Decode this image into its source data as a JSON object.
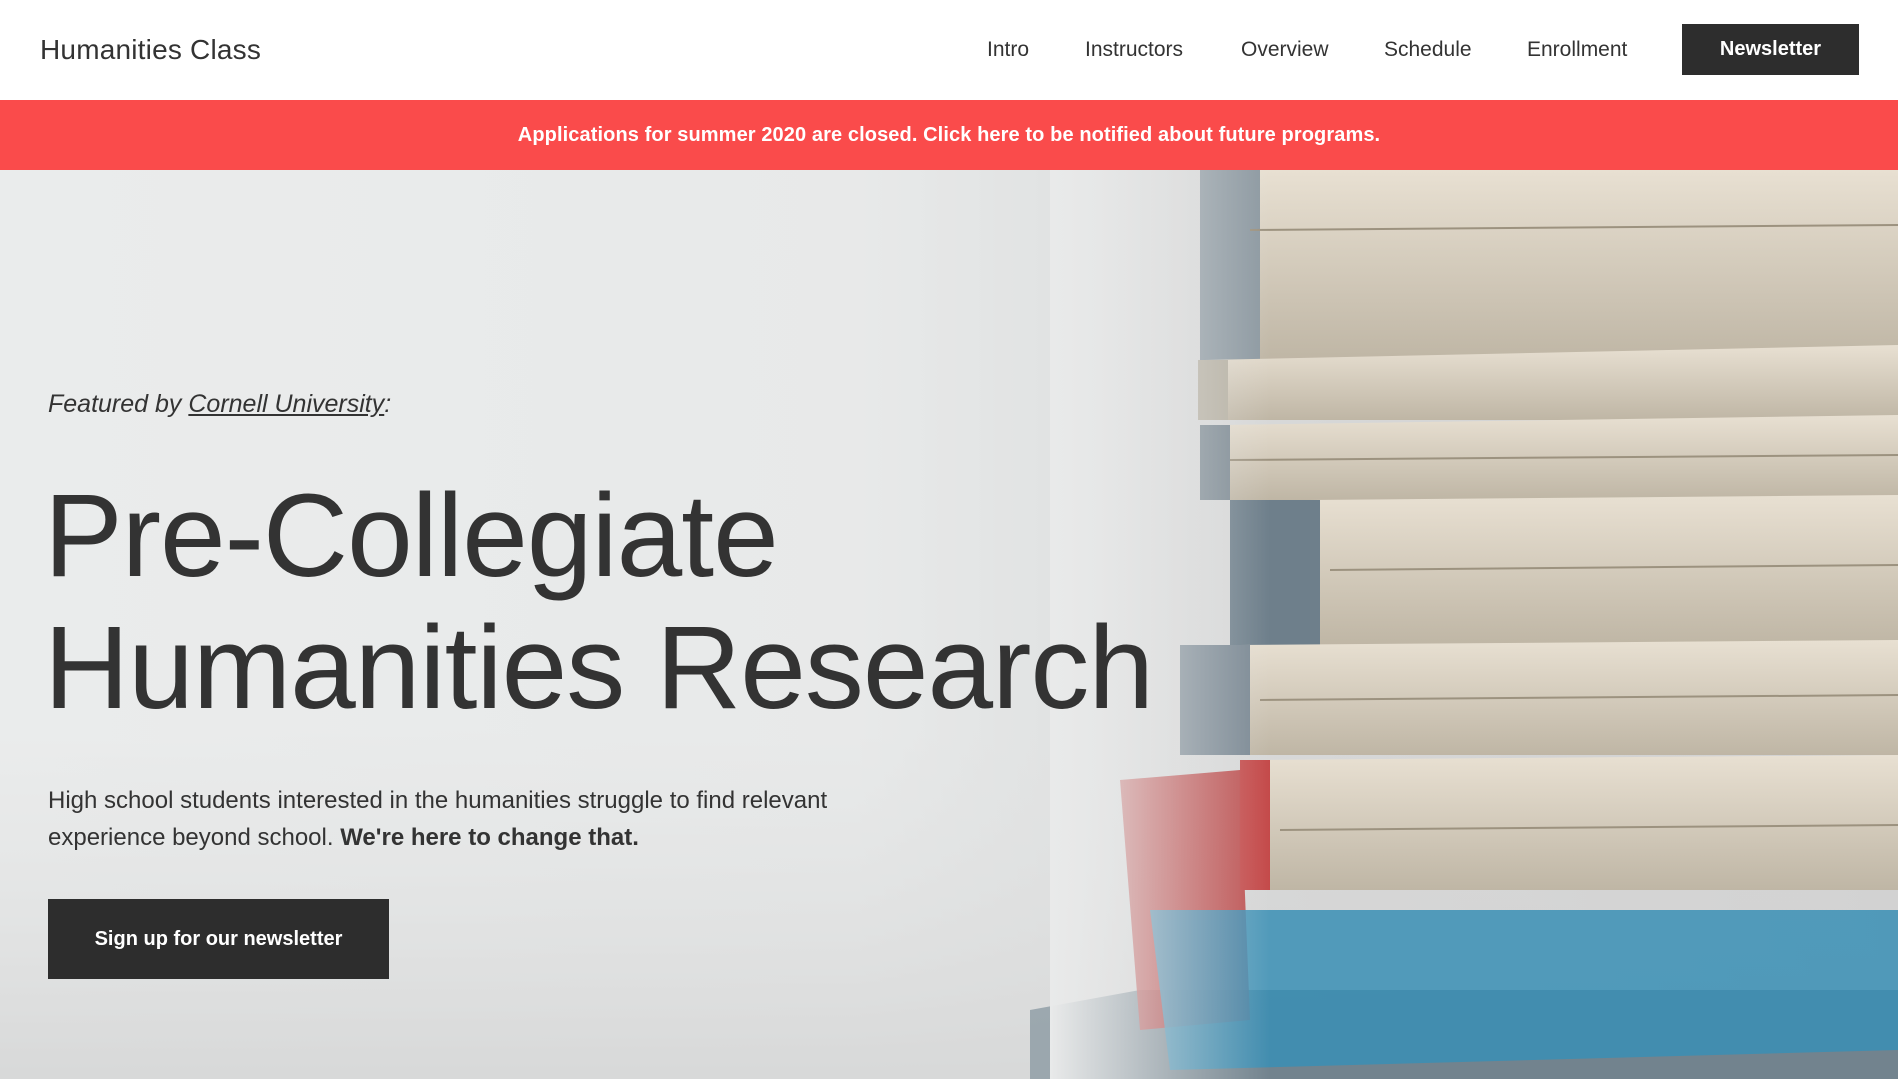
{
  "header": {
    "brand": "Humanities Class",
    "nav": [
      {
        "label": "Intro"
      },
      {
        "label": "Instructors"
      },
      {
        "label": "Overview"
      },
      {
        "label": "Schedule"
      },
      {
        "label": "Enrollment"
      }
    ],
    "newsletter_button": "Newsletter"
  },
  "banner": {
    "text": "Applications for summer 2020 are closed. Click here to be notified about future programs.",
    "color": "#fa4b4b"
  },
  "hero": {
    "featured_prefix": "Featured by ",
    "featured_link": "Cornell University",
    "featured_suffix": ":",
    "headline_line1": "Pre-Collegiate",
    "headline_line2": "Humanities Research",
    "lede_text": "High school students interested in the humanities struggle to find relevant experience beyond school. ",
    "lede_bold": "We're here to change that.",
    "cta_label": "Sign up for our newsletter",
    "background_image": "stack-of-books-photo"
  },
  "colors": {
    "text": "#333333",
    "button_bg": "#2d2d2d",
    "banner": "#fa4b4b"
  }
}
